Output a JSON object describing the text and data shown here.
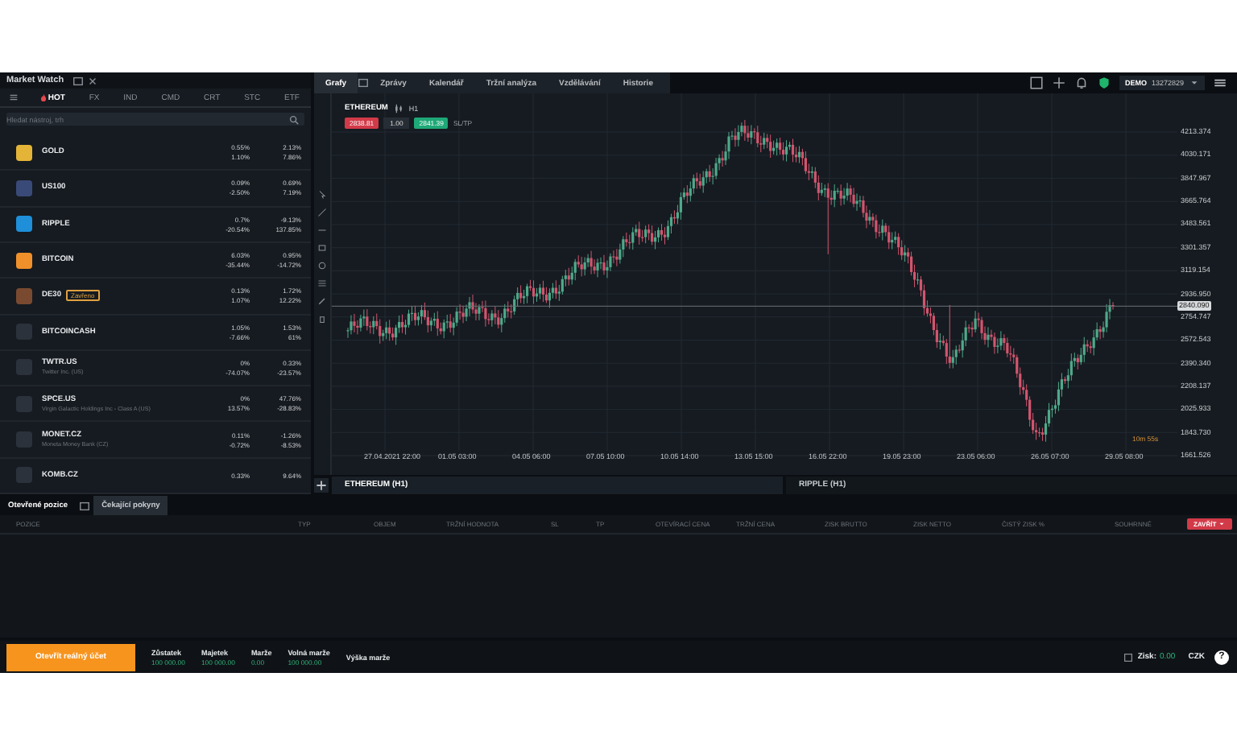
{
  "market_watch": {
    "title": "Market Watch",
    "tabs": [
      {
        "label": "HOT",
        "selected": true
      },
      {
        "label": "FX",
        "selected": false
      },
      {
        "label": "IND",
        "selected": false
      },
      {
        "label": "CMD",
        "selected": false
      },
      {
        "label": "CRT",
        "selected": false
      },
      {
        "label": "STC",
        "selected": false
      },
      {
        "label": "ETF",
        "selected": false
      }
    ],
    "search": {
      "placeholder": "Hledat nástroj, trh"
    },
    "instruments": [
      {
        "symbol": "GOLD",
        "color": "#e3b437",
        "changes": [
          "0.55%",
          "1.10%"
        ],
        "changes_2": [
          "2.13%",
          "7.86%"
        ]
      },
      {
        "symbol": "US100",
        "color": "#3a4a78",
        "changes": [
          "0.09%",
          "-2.50%"
        ],
        "changes_2": [
          "0.69%",
          "7.19%"
        ]
      },
      {
        "symbol": "RIPPLE",
        "color": "#1e8fd8",
        "changes": [
          "0.7%",
          "-20.54%"
        ],
        "changes_2": [
          "-9.13%",
          "137.85%"
        ]
      },
      {
        "symbol": "BITCOIN",
        "color": "#f0902a",
        "changes": [
          "6.03%",
          "-35.44%"
        ],
        "changes_2": [
          "0.95%",
          "-14.72%"
        ]
      },
      {
        "symbol": "DE30",
        "badge": "Zavřeno",
        "color": "#7a4a30",
        "changes": [
          "0.13%",
          "1.07%"
        ],
        "changes_2": [
          "1.72%",
          "12.22%"
        ]
      },
      {
        "symbol": "BITCOINCASH",
        "color": "#2b323b",
        "changes": [
          "1.05%",
          "-7.66%"
        ],
        "changes_2": [
          "1.53%",
          "61%"
        ]
      },
      {
        "symbol": "TWTR.US",
        "subtitle": "Twitter Inc. (US)",
        "color": "#2b323b",
        "changes": [
          "0%",
          "-74.07%"
        ],
        "changes_2": [
          "0.33%",
          "-23.57%"
        ]
      },
      {
        "symbol": "SPCE.US",
        "subtitle": "Virgin Galactic Holdings Inc - Class A (US)",
        "color": "#2b323b",
        "changes": [
          "0%",
          "13.57%"
        ],
        "changes_2": [
          "47.76%",
          "-28.83%"
        ]
      },
      {
        "symbol": "MONET.CZ",
        "subtitle": "Moneta Money Bank (CZ)",
        "color": "#2b323b",
        "changes": [
          "0.11%",
          "-0.72%"
        ],
        "changes_2": [
          "-1.26%",
          "-8.53%"
        ]
      },
      {
        "symbol": "KOMB.CZ",
        "color": "#2b323b",
        "changes": [
          "0.33%"
        ],
        "changes_2": [
          "9.64%"
        ]
      }
    ]
  },
  "top_tabs": [
    {
      "label": "Grafy",
      "selected": true
    },
    {
      "label": "Zprávy",
      "selected": false
    },
    {
      "label": "Kalendář",
      "selected": false
    },
    {
      "label": "Tržní analýza",
      "selected": false
    },
    {
      "label": "Vzdělávání",
      "selected": false
    },
    {
      "label": "Historie",
      "selected": false
    }
  ],
  "account": {
    "mode": "DEMO",
    "number": "13272829"
  },
  "chart": {
    "symbol": "ETHEREUM",
    "timeframe": "H1",
    "sell": "2838.81",
    "volume": "1.00",
    "buy": "2841.39",
    "sltp": "SL/TP",
    "current_price": "2840.090",
    "countdown": "10m 55s",
    "y_labels": [
      "4213.374",
      "4030.171",
      "3847.967",
      "3665.764",
      "3483.561",
      "3301.357",
      "3119.154",
      "2936.950",
      "2754.747",
      "2572.543",
      "2390.340",
      "2208.137",
      "2025.933",
      "1843.730",
      "1661.526"
    ],
    "x_labels": [
      "27.04.2021 22:00",
      "01.05 03:00",
      "04.05 06:00",
      "07.05 10:00",
      "10.05 14:00",
      "13.05 15:00",
      "16.05 22:00",
      "19.05 23:00",
      "23.05 06:00",
      "26.05 07:00",
      "29.05 08:00"
    ]
  },
  "chart_tabs": [
    {
      "label": "ETHEREUM (H1)",
      "selected": true
    },
    {
      "label": "RIPPLE (H1)",
      "selected": false
    }
  ],
  "positions": {
    "tabs": [
      {
        "label": "Otevřené pozice",
        "selected": true
      },
      {
        "label": "Čekající pokyny",
        "selected": false
      }
    ],
    "columns": [
      "POZICE",
      "TYP",
      "OBJEM",
      "TRŽNÍ HODNOTA",
      "SL",
      "TP",
      "OTEVÍRACÍ CENA",
      "TRŽNÍ CENA",
      "ZISK BRUTTO",
      "ZISK NETTO",
      "ČISTÝ ZISK %",
      "SOUHRNNÉ"
    ],
    "close_button": "ZAVŘÍT"
  },
  "footer": {
    "open_account": "Otevřít reálný účet",
    "stats": [
      {
        "label": "Zůstatek",
        "value": "100 000.00"
      },
      {
        "label": "Majetek",
        "value": "100 000.00"
      },
      {
        "label": "Marže",
        "value": "0.00"
      },
      {
        "label": "Volná marže",
        "value": "100 000.00"
      },
      {
        "label": "Výška marže"
      }
    ],
    "profit_label": "Zisk:",
    "profit_value": "0.00",
    "currency": "CZK",
    "help": "?"
  }
}
